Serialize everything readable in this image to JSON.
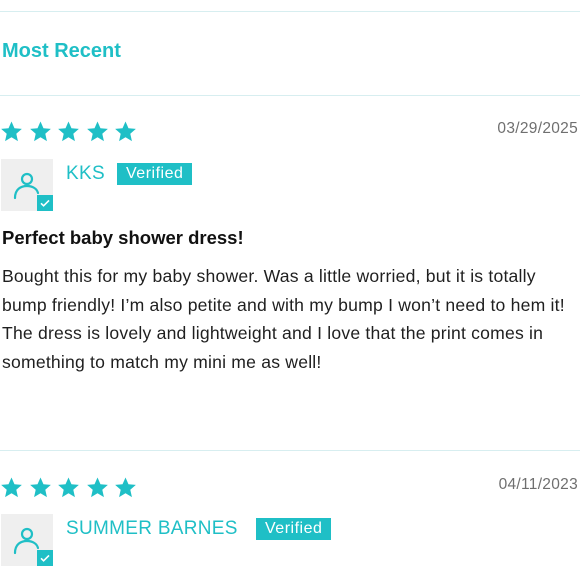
{
  "sort": {
    "label": "Most Recent"
  },
  "colors": {
    "accent": "#1fbfc6",
    "divider": "#d7eef0",
    "avatar_bg": "#efefef",
    "date_text": "#6f6f6f"
  },
  "reviews": [
    {
      "rating": 5,
      "date": "03/29/2025",
      "author": "KKS",
      "badge": "Verified",
      "title": "Perfect baby shower dress!",
      "body": "Bought this for my baby shower. Was a little worried, but it is totally bump friendly! I’m also petite and with my bump I won’t need to hem it! The dress is lovely and lightweight and I love that the print comes in something to match my mini me as well!"
    },
    {
      "rating": 5,
      "date": "04/11/2023",
      "author": "SUMMER BARNES",
      "badge": "Verified"
    }
  ]
}
